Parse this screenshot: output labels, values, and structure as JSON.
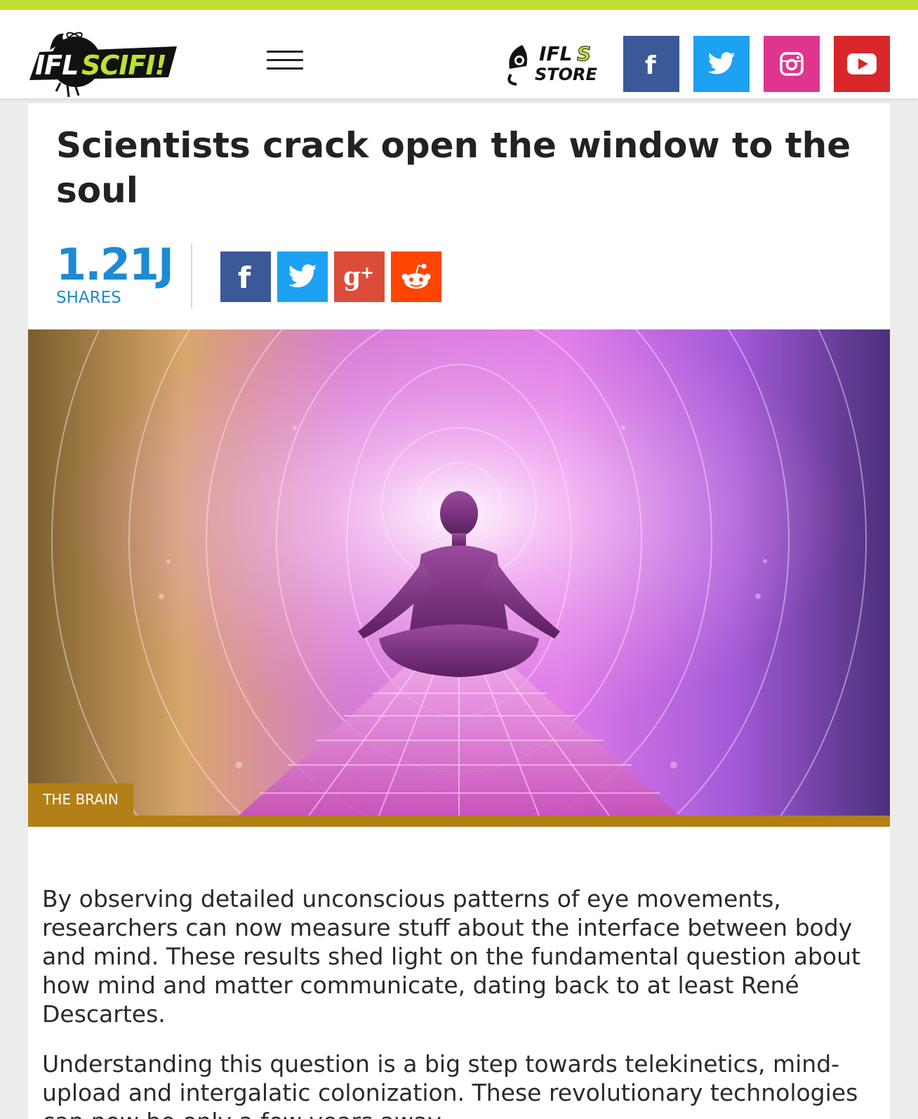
{
  "colors": {
    "topbar": "#bfe033",
    "facebook": "#3b5998",
    "twitter": "#1da1f2",
    "instagram": "#e0358f",
    "youtube": "#d8262b",
    "googleplus": "#dd4b39",
    "reddit": "#ff4500",
    "shares_blue": "#1e8ad2",
    "category": "#b38017"
  },
  "header": {
    "logo_text": "IFLSCIFI!",
    "menu_icon": "hamburger-icon",
    "store_logo_text": "IFLS STORE",
    "social_icons": [
      "facebook-icon",
      "twitter-icon",
      "instagram-icon",
      "youtube-icon"
    ]
  },
  "article": {
    "title": "Scientists crack open the window to the soul",
    "share_count": "1.21J",
    "share_label": "SHARES",
    "share_icons": [
      "facebook-icon",
      "twitter-icon",
      "google-plus-icon",
      "reddit-icon"
    ],
    "category": "THE BRAIN",
    "paragraphs": [
      "By observing detailed unconscious patterns of eye movements, researchers can now measure stuff about the interface between body and mind. These results shed light on the fundamental question about how mind and matter communicate, dating back to at least René Descartes.",
      "Understanding this question is a big step towards telekinetics, mind-upload and intergalatic colonization. These revolutionary technologies can now be only a few years away."
    ]
  }
}
